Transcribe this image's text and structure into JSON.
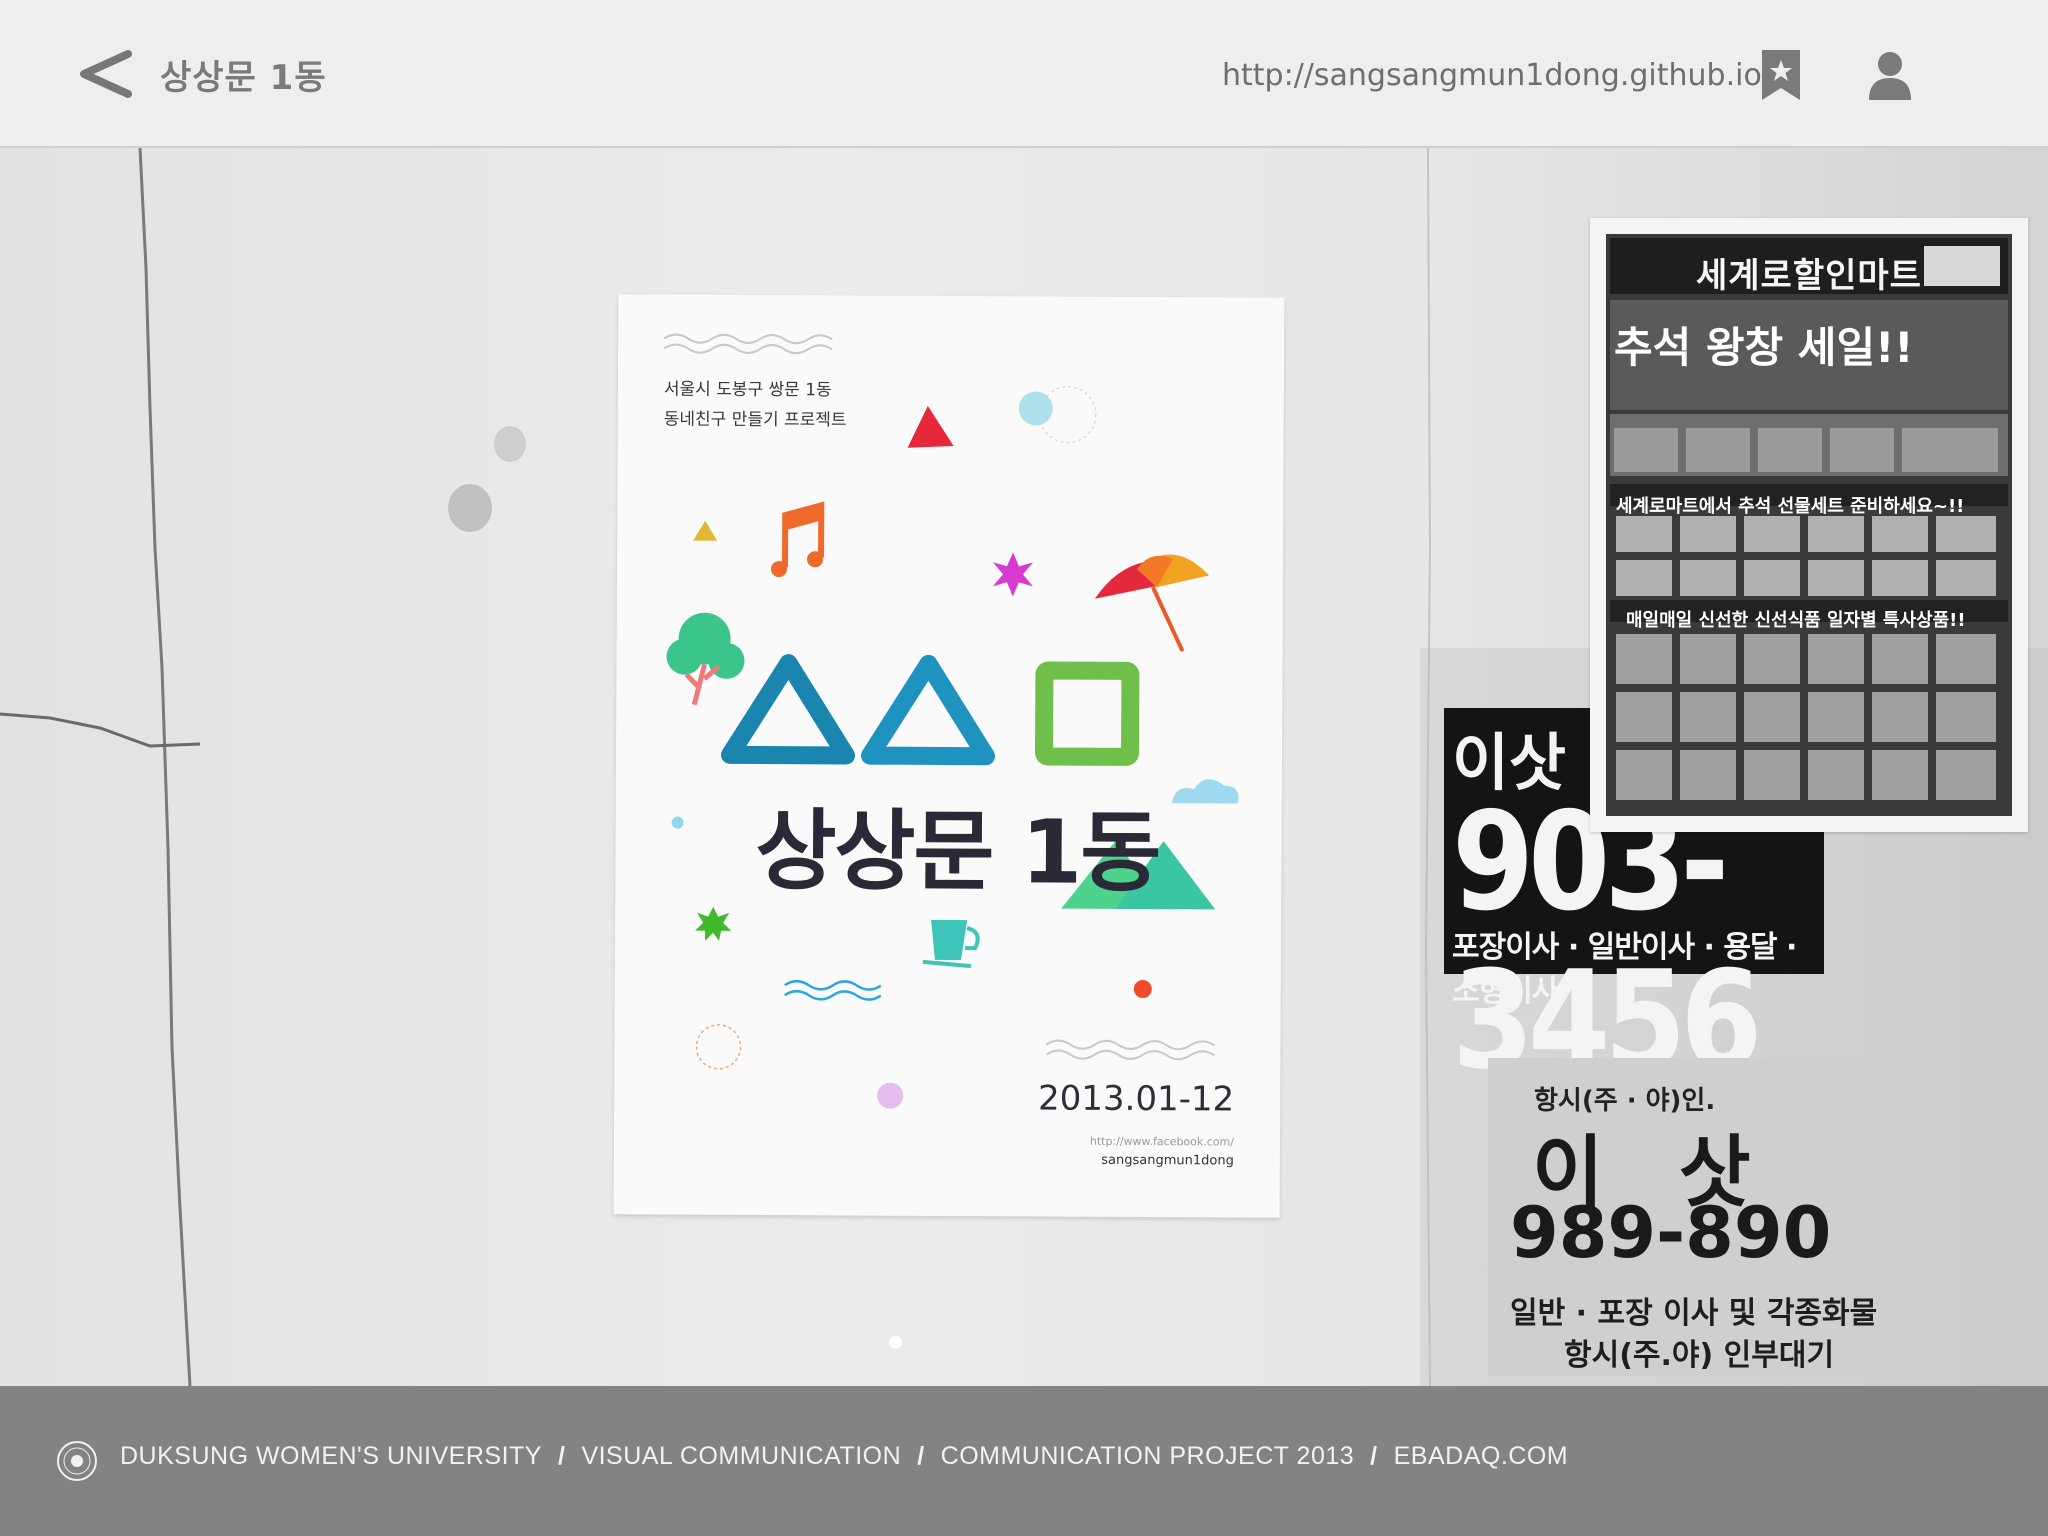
{
  "header": {
    "title": "상상문 1동",
    "url": "http://sangsangmun1dong.github.io/"
  },
  "poster": {
    "address_line1": "서울시 도봉구 쌍문 1동",
    "address_line2": "동네친구 만들기 프로젝트",
    "title": "상상문 1동",
    "date": "2013.01-12",
    "url": "http://www.facebook.com/",
    "handle": "sangsangmun1dong"
  },
  "flyer": {
    "store_name": "세계로할인마트",
    "sale_text": "추석 왕창 세일!!",
    "banner1": "세계로마트에서 추석 선물세트 준비하세요~!!",
    "banner2": "매일매일 신선한 신선식품 일자별 특사상품!!"
  },
  "moving_ad_1": {
    "top": "이삿",
    "phone": "903-3456",
    "services": "포장이사 · 일반이사 · 용달 · 소형이사"
  },
  "moving_ad_2": {
    "top": "항시(주 · 야)인.",
    "name": "이 삿",
    "phone": "989-890",
    "line1": "일반 · 포장 이사 및 각종화물",
    "line2": "항시(주.야) 인부대기"
  },
  "footer": {
    "links": [
      "DUKSUNG WOMEN'S UNIVERSITY",
      "VISUAL COMMUNICATION",
      "COMMUNICATION PROJECT 2013",
      "EBADAQ.COM"
    ],
    "separator": "/"
  },
  "icons": {
    "back": "chevron-left-icon",
    "bookmark": "bookmark-star-icon",
    "user": "user-icon",
    "logo": "university-seal-icon"
  },
  "colors": {
    "topbar": "#eeeeee",
    "footer": "#838383",
    "poster_blue": "#1a86b0",
    "poster_green": "#6fbf4a",
    "poster_red": "#e5283b"
  }
}
